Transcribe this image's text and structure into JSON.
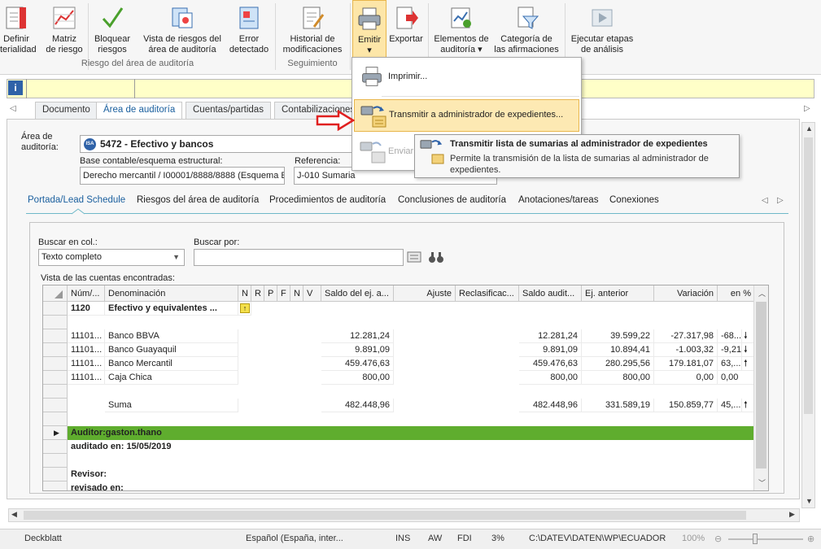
{
  "ribbon": {
    "buttons": [
      {
        "line1": "Definir",
        "line2": "terialidad",
        "icon": "report-icon"
      },
      {
        "line1": "Matriz",
        "line2": "de riesgo",
        "icon": "chart-icon"
      },
      {
        "line1": "Bloquear",
        "line2": "riesgos",
        "icon": "check-icon"
      },
      {
        "line1": "Vista de riesgos del",
        "line2": "área de auditoría",
        "icon": "view-icon"
      },
      {
        "line1": "Error",
        "line2": "detectado",
        "icon": "error-icon"
      },
      {
        "line1": "Historial de",
        "line2": "modificaciones",
        "icon": "history-icon"
      },
      {
        "line1": "Emitir",
        "line2": "▾",
        "icon": "printer-icon"
      },
      {
        "line1": "Exportar",
        "line2": "",
        "icon": "export-icon"
      },
      {
        "line1": "Elementos de",
        "line2": "auditoría ▾",
        "icon": "elements-icon"
      },
      {
        "line1": "Categoría de",
        "line2": "las afirmaciones",
        "icon": "filter-icon"
      },
      {
        "line1": "Ejecutar etapas",
        "line2": "de análisis",
        "icon": "run-icon"
      }
    ],
    "groups": {
      "risk": "Riesgo del área de auditoría",
      "tracking": "Seguimiento"
    }
  },
  "dropdown": {
    "items": [
      {
        "label": "Imprimir..."
      },
      {
        "label": "Transmitir a administrador de expedientes..."
      },
      {
        "label": "Enviar"
      }
    ]
  },
  "tooltip": {
    "title": "Transmitir lista de sumarias al administrador de expedientes",
    "line1": "Permite la transmisión de la lista de sumarias al administrador de",
    "line2": "expedientes."
  },
  "main_tabs": [
    "Documento",
    "Área de auditoría",
    "Cuentas/partidas",
    "Contabilizaciones"
  ],
  "form": {
    "area_label_1": "Área de",
    "area_label_2": "auditoría:",
    "area_value": "5472 - Efectivo y bancos",
    "area_badge": "ISA",
    "base_label": "Base contable/esquema estructural:",
    "base_value": "Derecho mercantil / I00001/8888/8888 (Esquema E",
    "ref_label": "Referencia:",
    "ref_value": "J-010  Sumaria"
  },
  "sub_tabs": [
    "Portada/Lead Schedule",
    "Riesgos del área de auditoría",
    "Procedimientos de auditoría",
    "Conclusiones de auditoría",
    "Anotaciones/tareas",
    "Conexiones"
  ],
  "search": {
    "col_label": "Buscar en col.:",
    "col_value": "Texto completo",
    "by_label": "Buscar por:",
    "by_value": "",
    "list_label": "Vista de las cuentas encontradas:"
  },
  "grid": {
    "headers": [
      "Núm/...",
      "Denominación",
      "N",
      "R",
      "P",
      "F",
      "N",
      "V",
      "Saldo del ej. a...",
      "Ajuste",
      "Reclasificac...",
      "Saldo audit...",
      "Ej. anterior",
      "Variación",
      "en %"
    ],
    "rows": [
      {
        "num": "1120",
        "name": "Efectivo y equivalentes ...",
        "saldo": "",
        "saldo_aud": "",
        "anterior": "",
        "variacion": "",
        "pct": "",
        "bold": true,
        "flag": true
      },
      {
        "num": "",
        "name": "",
        "saldo": "",
        "saldo_aud": "",
        "anterior": "",
        "variacion": "",
        "pct": ""
      },
      {
        "num": "11101...",
        "name": "Banco BBVA",
        "saldo": "12.281,24",
        "saldo_aud": "12.281,24",
        "anterior": "39.599,22",
        "variacion": "-27.317,98",
        "pct": "-68...",
        "trend": "down"
      },
      {
        "num": "11101...",
        "name": "Banco Guayaquil",
        "saldo": "9.891,09",
        "saldo_aud": "9.891,09",
        "anterior": "10.894,41",
        "variacion": "-1.003,32",
        "pct": "-9,21",
        "trend": "down"
      },
      {
        "num": "11101...",
        "name": "Banco Mercantil",
        "saldo": "459.476,63",
        "saldo_aud": "459.476,63",
        "anterior": "280.295,56",
        "variacion": "179.181,07",
        "pct": "63,...",
        "trend": "up"
      },
      {
        "num": "11101...",
        "name": "Caja Chica",
        "saldo": "800,00",
        "saldo_aud": "800,00",
        "anterior": "800,00",
        "variacion": "0,00",
        "pct": "0,00",
        "trend": ""
      },
      {
        "num": "",
        "name": "",
        "saldo": "",
        "saldo_aud": "",
        "anterior": "",
        "variacion": "",
        "pct": ""
      },
      {
        "num": "",
        "name": "Suma",
        "saldo": "482.448,96",
        "saldo_aud": "482.448,96",
        "anterior": "331.589,19",
        "variacion": "150.859,77",
        "pct": "45,...",
        "trend": "up"
      }
    ],
    "auditor": "Auditor:gaston.thano",
    "audited": "auditado en: 15/05/2019",
    "reviewer": "Revisor:",
    "reviewed": "revisado en:"
  },
  "status": {
    "left": "Deckblatt",
    "language": "Español (España, inter...",
    "ins": "INS",
    "aw": "AW",
    "fdi": "FDI",
    "pct": "3%",
    "path": "C:\\DATEV\\DATEN\\WP\\ECUADOR",
    "zoom": "100%"
  },
  "colors": {
    "accent": "#1a5f9e",
    "green_row": "#5fad2e",
    "highlight": "#fde9b3",
    "info_bar": "#ffffc8"
  }
}
